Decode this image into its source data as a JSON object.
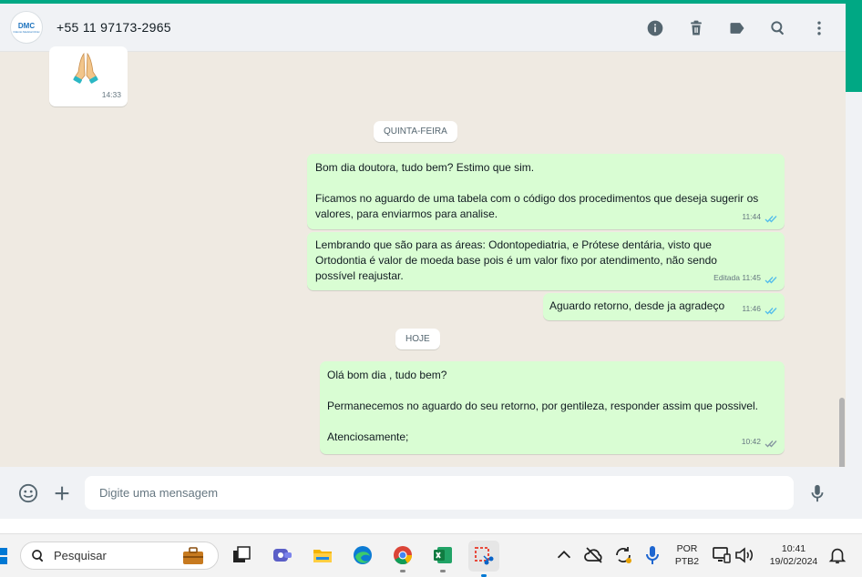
{
  "header": {
    "contact_name": "+55 11 97173-2965",
    "avatar_logo_text": "DMC",
    "avatar_logo_sub": "Odonto Medical Clinic"
  },
  "messages": {
    "emoji_msg": {
      "time": "14:33"
    },
    "day1": "QUINTA-FEIRA",
    "m1": {
      "text": "Bom dia doutora, tudo bem? Estimo que sim.\n\nFicamos no aguardo de uma tabela com o código dos procedimentos que deseja sugerir os valores, para enviarmos para analise.",
      "time": "11:44"
    },
    "m2": {
      "text": "Lembrando que são para as áreas: Odontopediatria, e Prótese dentária, visto que Ortodontia é valor de moeda base pois é um valor fixo por atendimento, não sendo possível reajustar.",
      "time": "Editada 11:45"
    },
    "m3": {
      "text": "Aguardo retorno, desde ja agradeço",
      "time": "11:46"
    },
    "day2": "HOJE",
    "m4": {
      "text": "Olá bom dia , tudo bem?\n\nPermanecemos no aguardo do seu retorno, por gentileza, responder assim que possivel.\n\nAtenciosamente;",
      "time": "10:42"
    }
  },
  "composer": {
    "placeholder": "Digite uma mensagem"
  },
  "taskbar": {
    "search_label": "Pesquisar",
    "lang_top": "POR",
    "lang_bottom": "PTB2",
    "clock_time": "10:41",
    "clock_date": "19/02/2024"
  },
  "colors": {
    "accent": "#00a884",
    "outgoing_bubble": "#d9fdd3",
    "chat_bg": "#efeae2",
    "read_ticks": "#53bdeb"
  }
}
